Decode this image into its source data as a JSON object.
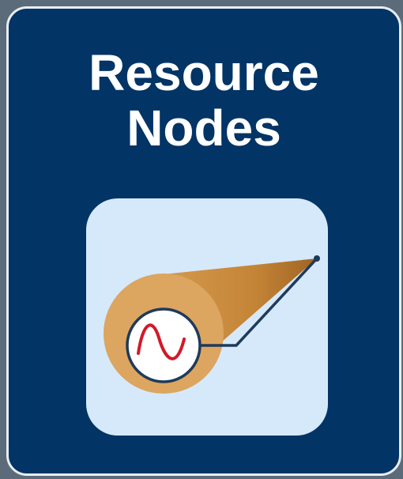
{
  "card": {
    "title_line1": "Resource",
    "title_line2": "Nodes",
    "background_color": "#023466",
    "border_color": "#e8eef4",
    "text_color": "#ffffff"
  },
  "icon": {
    "name": "resource-node-cable-icon",
    "tile_color": "#d6e9fb",
    "cone_color": "#c8893a",
    "end_color": "#dca560",
    "wave_color": "#d11a2a",
    "line_color": "#1f3a5a"
  }
}
